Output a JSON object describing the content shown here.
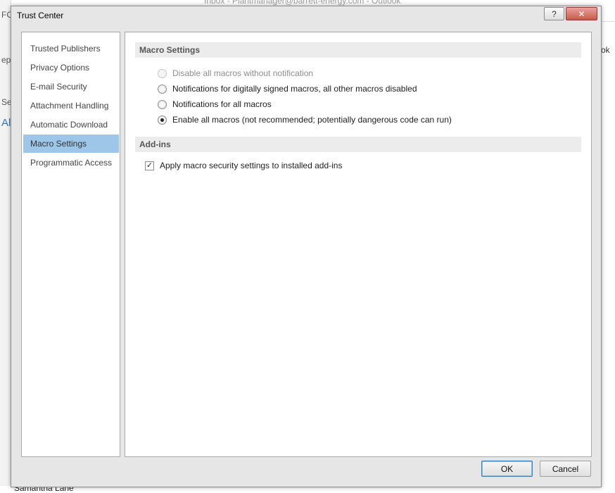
{
  "background": {
    "outlook_title": "Inbox - Plantmanager@barrett-energy.com - Outlook",
    "left_fragments": [
      "FC",
      "eph",
      "Se",
      "Al"
    ],
    "right_fragments": [
      "ok"
    ],
    "bottom_fragment": "Samantha Lane"
  },
  "dialog": {
    "title": "Trust Center",
    "help_glyph": "?",
    "close_glyph": "✕"
  },
  "nav": {
    "items": [
      {
        "label": "Trusted Publishers"
      },
      {
        "label": "Privacy Options"
      },
      {
        "label": "E-mail Security"
      },
      {
        "label": "Attachment Handling"
      },
      {
        "label": "Automatic Download"
      },
      {
        "label": "Macro Settings",
        "selected": true
      },
      {
        "label": "Programmatic Access"
      }
    ]
  },
  "macro_settings": {
    "header": "Macro Settings",
    "options": [
      {
        "label": "Disable all macros without notification",
        "checked": false,
        "disabled": true
      },
      {
        "label": "Notifications for digitally signed macros, all other macros disabled",
        "checked": false,
        "disabled": false
      },
      {
        "label": "Notifications for all macros",
        "checked": false,
        "disabled": false
      },
      {
        "label": "Enable all macros (not recommended; potentially dangerous code can run)",
        "checked": true,
        "disabled": false
      }
    ]
  },
  "addins": {
    "header": "Add-ins",
    "checkbox_label": "Apply macro security settings to installed add-ins",
    "checked": true,
    "check_glyph": "✓"
  },
  "buttons": {
    "ok": "OK",
    "cancel": "Cancel"
  },
  "colors": {
    "selected_nav": "#9ec6e8",
    "dialog_bg": "#e6e6e6",
    "section_header_bg": "#ececec"
  }
}
